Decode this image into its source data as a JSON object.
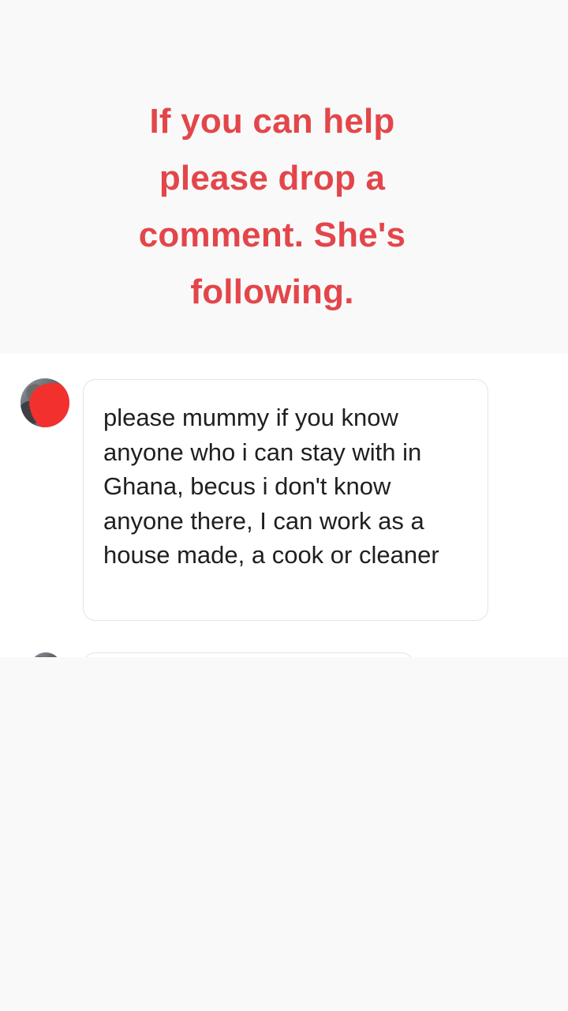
{
  "overlay": {
    "caption": "If you can help\nplease drop a\ncomment. She's\nfollowing."
  },
  "comment": {
    "avatar_icon": "avatar-redacted",
    "text": "please mummy if you know anyone who i can stay with in Ghana, becus i don't know anyone there, I can work as a house made, a cook or cleaner"
  },
  "colors": {
    "caption": "#e3464a",
    "redaction": "#f2302e",
    "background": "#f9f9f9",
    "panel": "#ffffff"
  }
}
